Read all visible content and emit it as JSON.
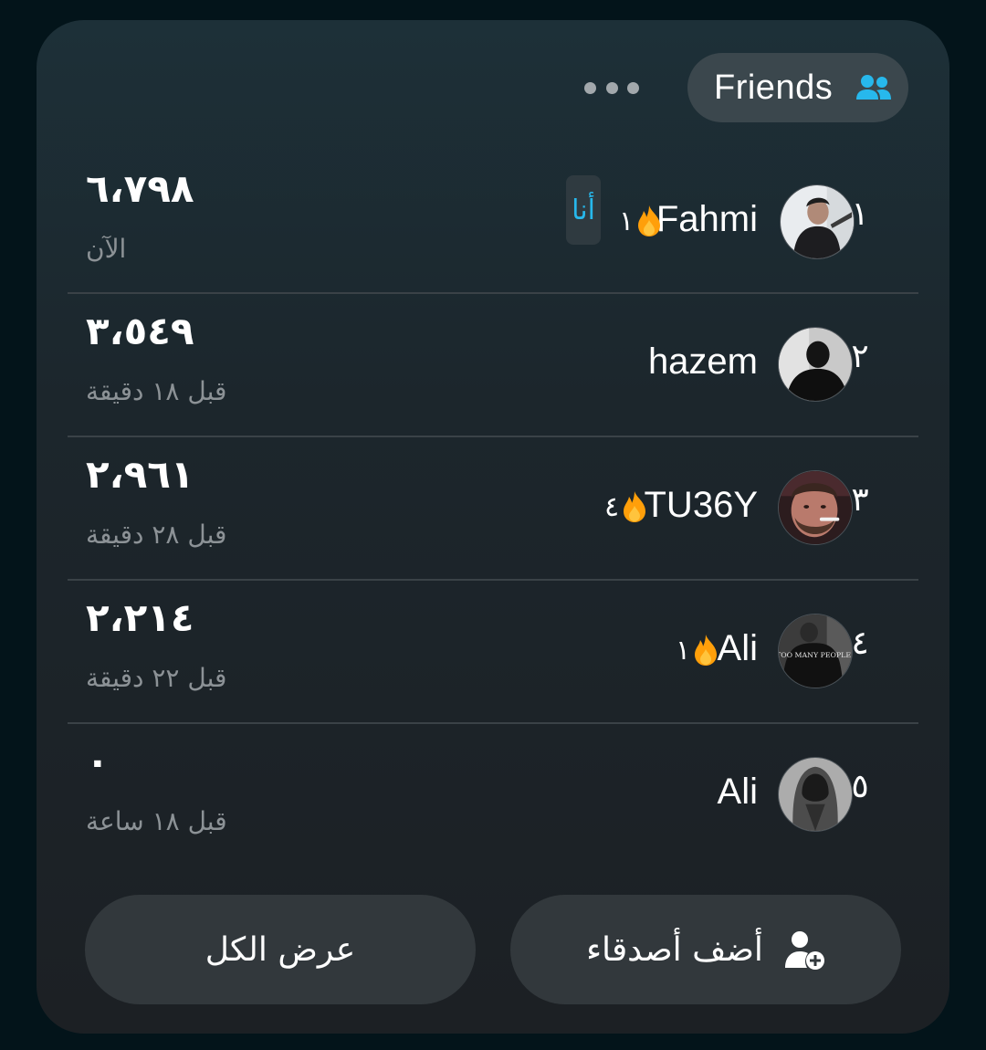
{
  "header": {
    "friends_label": "Friends",
    "friends_icon": "people-icon",
    "more_icon": "more-dots-icon"
  },
  "leaderboard": [
    {
      "rank": "١",
      "name": "Fahmi",
      "streak": "١",
      "me_badge": "أنا",
      "score": "٦،٧٩٨",
      "time": "الآن"
    },
    {
      "rank": "٢",
      "name": "hazem",
      "streak": "",
      "me_badge": "",
      "score": "٣،٥٤٩",
      "time": "قبل ١٨ دقيقة"
    },
    {
      "rank": "٣",
      "name": "TU36Y",
      "streak": "٤",
      "me_badge": "",
      "score": "٢،٩٦١",
      "time": "قبل ٢٨ دقيقة"
    },
    {
      "rank": "٤",
      "name": "Ali",
      "streak": "١",
      "me_badge": "",
      "score": "٢،٢١٤",
      "time": "قبل ٢٢ دقيقة"
    },
    {
      "rank": "٥",
      "name": "Ali",
      "streak": "",
      "me_badge": "",
      "score": "٠",
      "time": "قبل ١٨ ساعة"
    }
  ],
  "avatar_texts": {
    "ali_shirt": "TOO MANY PEOPLE"
  },
  "actions": {
    "view_all_label": "عرض الكل",
    "add_friends_label": "أضف أصدقاء",
    "add_friends_icon": "add-user-icon"
  },
  "colors": {
    "accent": "#27b8ec",
    "flame": "#ff9f0a",
    "background": "#03141a",
    "card": "#1c262c",
    "pill": "#3b474d",
    "button": "#32383c",
    "muted_text": "#8c9296"
  }
}
